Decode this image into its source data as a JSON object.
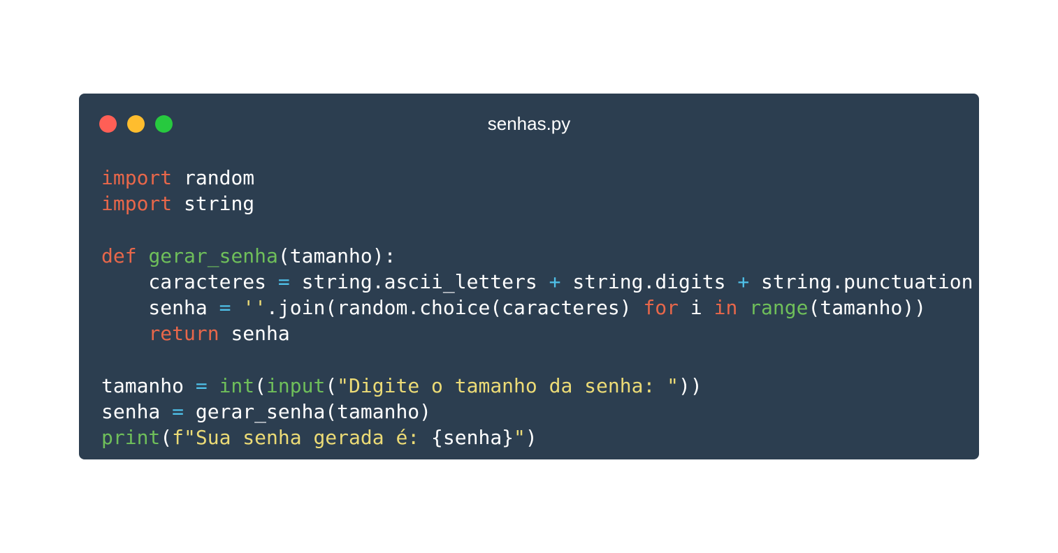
{
  "window": {
    "title": "senhas.py",
    "controls": [
      "close",
      "minimize",
      "maximize"
    ]
  },
  "colors": {
    "background": "#2c3e50",
    "keyword": "#e8674a",
    "function": "#6fbf5a",
    "string": "#ecdb76",
    "operator": "#4fc1e9",
    "text": "#ffffff"
  },
  "code": {
    "lines": [
      [
        {
          "t": "import",
          "k": "kw"
        },
        {
          "t": " random",
          "k": "plain"
        }
      ],
      [
        {
          "t": "import",
          "k": "kw"
        },
        {
          "t": " string",
          "k": "plain"
        }
      ],
      [],
      [
        {
          "t": "def",
          "k": "kw"
        },
        {
          "t": " ",
          "k": "plain"
        },
        {
          "t": "gerar_senha",
          "k": "fn"
        },
        {
          "t": "(tamanho):",
          "k": "plain"
        }
      ],
      [
        {
          "t": "    caracteres ",
          "k": "plain"
        },
        {
          "t": "=",
          "k": "op"
        },
        {
          "t": " string.ascii_letters ",
          "k": "plain"
        },
        {
          "t": "+",
          "k": "op"
        },
        {
          "t": " string.digits ",
          "k": "plain"
        },
        {
          "t": "+",
          "k": "op"
        },
        {
          "t": " string.punctuation",
          "k": "plain"
        }
      ],
      [
        {
          "t": "    senha ",
          "k": "plain"
        },
        {
          "t": "=",
          "k": "op"
        },
        {
          "t": " ",
          "k": "plain"
        },
        {
          "t": "''",
          "k": "str"
        },
        {
          "t": ".join(random.choice(caracteres) ",
          "k": "plain"
        },
        {
          "t": "for",
          "k": "kw"
        },
        {
          "t": " i ",
          "k": "plain"
        },
        {
          "t": "in",
          "k": "kw"
        },
        {
          "t": " ",
          "k": "plain"
        },
        {
          "t": "range",
          "k": "fn"
        },
        {
          "t": "(tamanho))",
          "k": "plain"
        }
      ],
      [
        {
          "t": "    ",
          "k": "plain"
        },
        {
          "t": "return",
          "k": "kw"
        },
        {
          "t": " senha",
          "k": "plain"
        }
      ],
      [],
      [
        {
          "t": "tamanho ",
          "k": "plain"
        },
        {
          "t": "=",
          "k": "op"
        },
        {
          "t": " ",
          "k": "plain"
        },
        {
          "t": "int",
          "k": "fn"
        },
        {
          "t": "(",
          "k": "plain"
        },
        {
          "t": "input",
          "k": "fn"
        },
        {
          "t": "(",
          "k": "plain"
        },
        {
          "t": "\"Digite o tamanho da senha: \"",
          "k": "str"
        },
        {
          "t": "))",
          "k": "plain"
        }
      ],
      [
        {
          "t": "senha ",
          "k": "plain"
        },
        {
          "t": "=",
          "k": "op"
        },
        {
          "t": " gerar_senha(tamanho)",
          "k": "plain"
        }
      ],
      [
        {
          "t": "print",
          "k": "fn"
        },
        {
          "t": "(",
          "k": "plain"
        },
        {
          "t": "f\"Sua senha gerada é: ",
          "k": "str"
        },
        {
          "t": "{senha}",
          "k": "plain"
        },
        {
          "t": "\"",
          "k": "str"
        },
        {
          "t": ")",
          "k": "plain"
        }
      ]
    ]
  }
}
